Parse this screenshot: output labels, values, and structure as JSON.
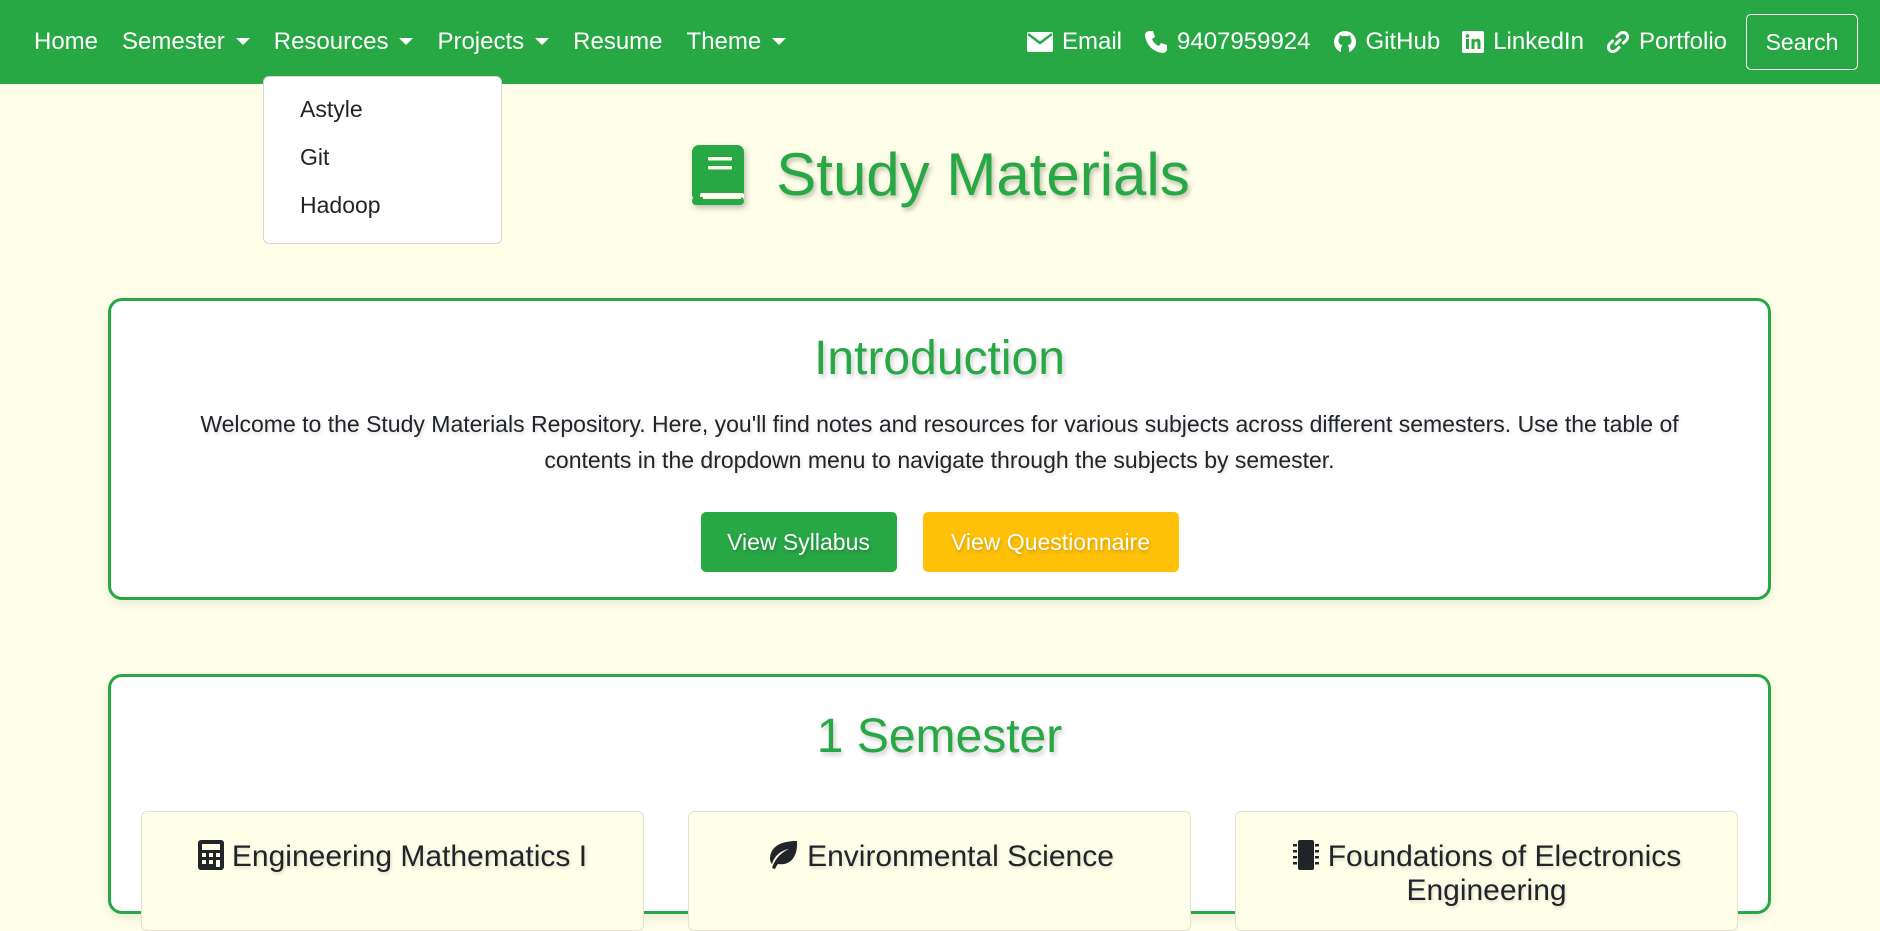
{
  "nav": {
    "home": "Home",
    "semester": "Semester",
    "resources": "Resources",
    "projects": "Projects",
    "resume": "Resume",
    "theme": "Theme",
    "email": "Email",
    "phone": "9407959924",
    "github": "GitHub",
    "linkedin": "LinkedIn",
    "portfolio": "Portfolio",
    "search": "Search"
  },
  "resources_menu": [
    "Astyle",
    "Git",
    "Hadoop"
  ],
  "page_title": "Study Materials",
  "intro": {
    "heading": "Introduction",
    "text": "Welcome to the Study Materials Repository. Here, you'll find notes and resources for various subjects across different semesters. Use the table of contents in the dropdown menu to navigate through the subjects by semester.",
    "btn_syllabus": "View Syllabus",
    "btn_questionnaire": "View Questionnaire"
  },
  "semester": {
    "heading": "1 Semester",
    "subjects": [
      {
        "name": "Engineering Mathematics I",
        "icon": "calculator-icon"
      },
      {
        "name": "Environmental Science",
        "icon": "leaf-icon"
      },
      {
        "name": "Foundations of Electronics Engineering",
        "icon": "microchip-icon"
      }
    ]
  },
  "colors": {
    "brand": "#28a745",
    "warning": "#ffc107",
    "background": "#fefee9"
  }
}
